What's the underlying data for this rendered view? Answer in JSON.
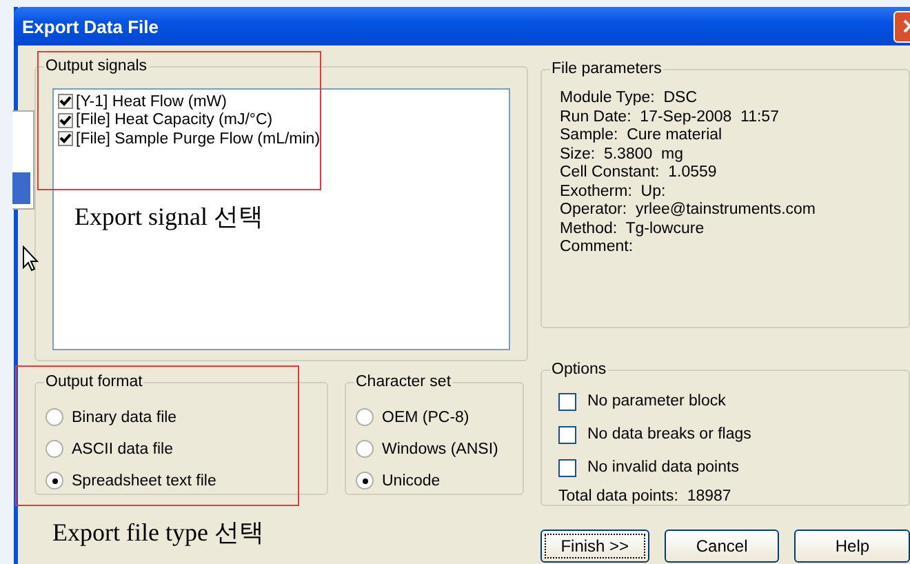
{
  "window": {
    "title": "Export Data File"
  },
  "output_signals": {
    "title": "Output signals",
    "items": [
      {
        "label": "[Y-1] Heat Flow (mW)",
        "checked": true
      },
      {
        "label": "[File] Heat Capacity (mJ/°C)",
        "checked": true
      },
      {
        "label": "[File] Sample Purge Flow (mL/min)",
        "checked": true
      }
    ]
  },
  "file_parameters": {
    "title": "File parameters",
    "lines": [
      "Module Type:  DSC",
      "Run Date:  17-Sep-2008  11:57",
      "Sample:  Cure material",
      "Size:  5.3800  mg",
      "Cell Constant:  1.0559",
      "Exotherm:  Up:",
      "Operator:  yrlee@tainstruments.com",
      "Method:  Tg-lowcure",
      "Comment:"
    ]
  },
  "output_format": {
    "title": "Output format",
    "options": [
      {
        "label": "Binary data file",
        "selected": false
      },
      {
        "label": "ASCII data file",
        "selected": false
      },
      {
        "label": "Spreadsheet text file",
        "selected": true
      }
    ]
  },
  "character_set": {
    "title": "Character set",
    "options": [
      {
        "label": "OEM (PC-8)",
        "selected": false
      },
      {
        "label": "Windows (ANSI)",
        "selected": false
      },
      {
        "label": "Unicode",
        "selected": true
      }
    ]
  },
  "options": {
    "title": "Options",
    "items": [
      {
        "label": "No parameter block",
        "checked": false
      },
      {
        "label": "No data breaks or flags",
        "checked": false
      },
      {
        "label": "No invalid data points",
        "checked": false
      }
    ],
    "total": "Total data points:  18987"
  },
  "buttons": [
    {
      "label": "Finish >>",
      "focused": true
    },
    {
      "label": "Cancel",
      "focused": false
    },
    {
      "label": "Help",
      "focused": false
    }
  ],
  "annotations": [
    "Export signal 선택",
    "Export file type 선택"
  ]
}
